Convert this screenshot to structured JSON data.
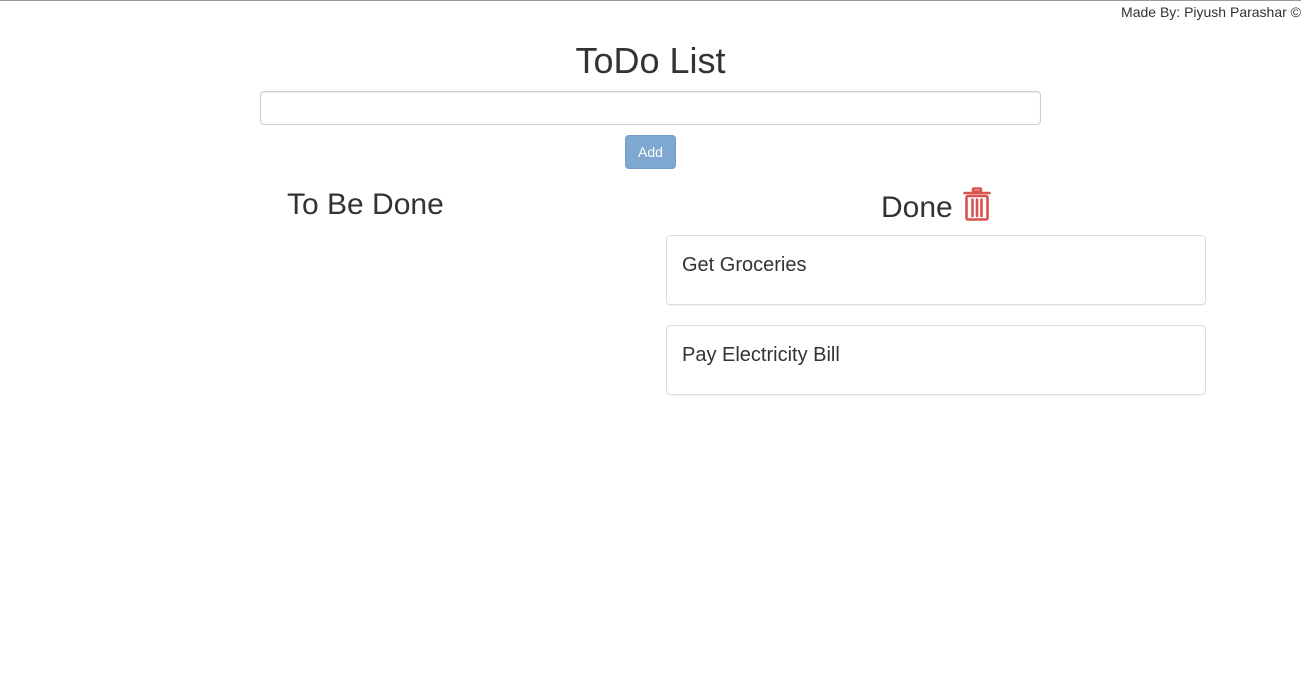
{
  "header": {
    "credit": "Made By: Piyush Parashar ©",
    "title": "ToDo List"
  },
  "form": {
    "input_value": "",
    "input_placeholder": "",
    "add_label": "Add"
  },
  "columns": {
    "pending_title": "To Be Done",
    "done_title": "Done",
    "done_clear_icon": "trash-icon"
  },
  "done_items": [
    {
      "label": "Get Groceries"
    },
    {
      "label": "Pay Electricity Bill"
    }
  ],
  "colors": {
    "add_button": "#7fa8d1",
    "trash_icon": "#d9534f",
    "text": "#333333"
  }
}
